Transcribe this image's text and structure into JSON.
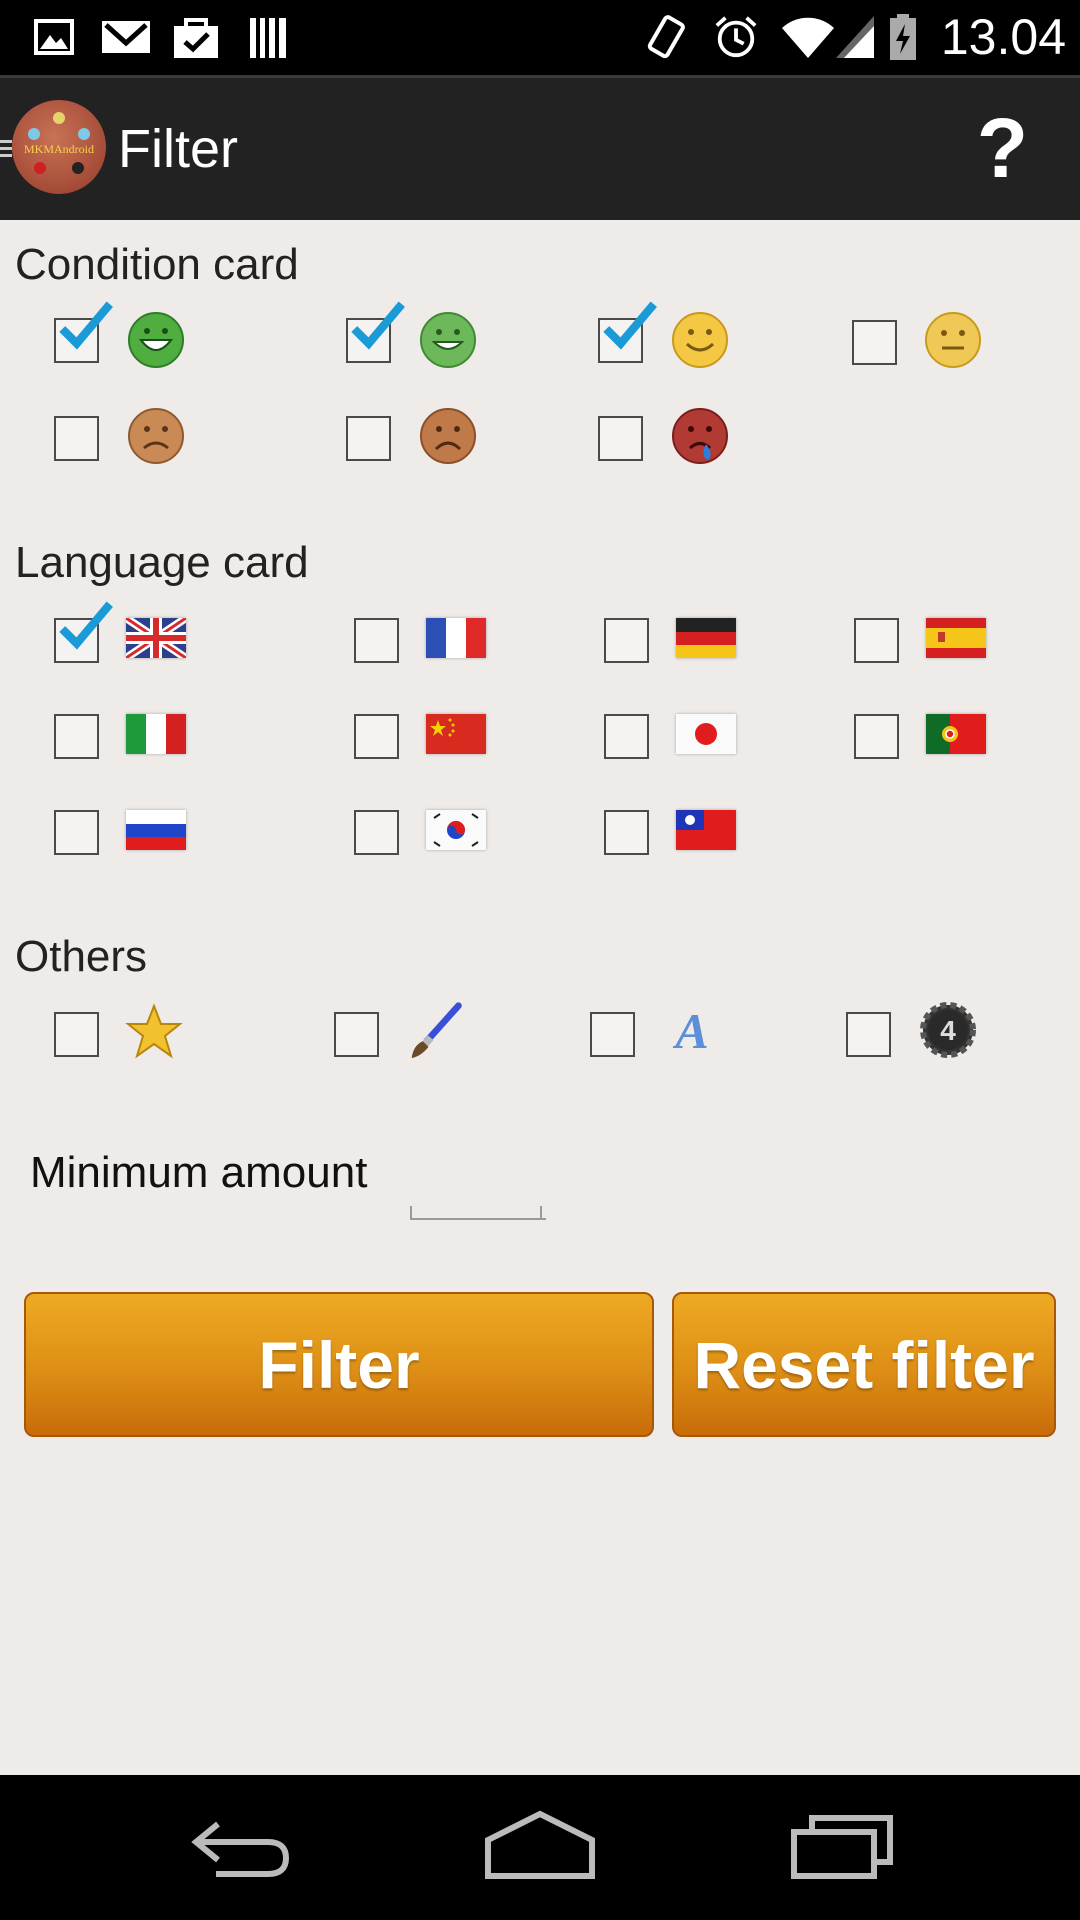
{
  "status_bar": {
    "time": "13.04",
    "icons": [
      "gallery-icon",
      "gmail-icon",
      "shopping-bag-icon",
      "barcode-icon",
      "vibrate-icon",
      "alarm-icon",
      "wifi-icon",
      "signal-icon",
      "battery-charging-icon"
    ]
  },
  "action_bar": {
    "logo_text": "MKMAndroid",
    "title": "Filter",
    "help_label": "?"
  },
  "condition": {
    "title": "Condition card",
    "items": [
      {
        "icon": "mint-smiley-icon",
        "checked": true
      },
      {
        "icon": "near-mint-smiley-icon",
        "checked": true
      },
      {
        "icon": "excellent-smiley-icon",
        "checked": true
      },
      {
        "icon": "good-neutral-face-icon",
        "checked": false
      },
      {
        "icon": "light-played-frown-icon",
        "checked": false
      },
      {
        "icon": "played-frown-icon",
        "checked": false
      },
      {
        "icon": "poor-crying-face-icon",
        "checked": false
      }
    ]
  },
  "language": {
    "title": "Language card",
    "items": [
      {
        "icon": "uk-flag-icon",
        "checked": true
      },
      {
        "icon": "france-flag-icon",
        "checked": false
      },
      {
        "icon": "germany-flag-icon",
        "checked": false
      },
      {
        "icon": "spain-flag-icon",
        "checked": false
      },
      {
        "icon": "italy-flag-icon",
        "checked": false
      },
      {
        "icon": "china-flag-icon",
        "checked": false
      },
      {
        "icon": "japan-flag-icon",
        "checked": false
      },
      {
        "icon": "portugal-flag-icon",
        "checked": false
      },
      {
        "icon": "russia-flag-icon",
        "checked": false
      },
      {
        "icon": "korea-flag-icon",
        "checked": false
      },
      {
        "icon": "taiwan-flag-icon",
        "checked": false
      }
    ]
  },
  "others": {
    "title": "Others",
    "items": [
      {
        "icon": "star-icon",
        "checked": false
      },
      {
        "icon": "paintbrush-icon",
        "checked": false
      },
      {
        "icon": "letter-a-icon",
        "checked": false
      },
      {
        "icon": "gear-4-icon",
        "checked": false
      }
    ]
  },
  "minimum_amount": {
    "label": "Minimum amount",
    "value": ""
  },
  "buttons": {
    "filter_label": "Filter",
    "reset_label": "Reset filter"
  },
  "colors": {
    "button_orange": "#dd8e15",
    "check_blue": "#1a9bd7",
    "background": "#efebe8",
    "action_bar": "#222222"
  }
}
